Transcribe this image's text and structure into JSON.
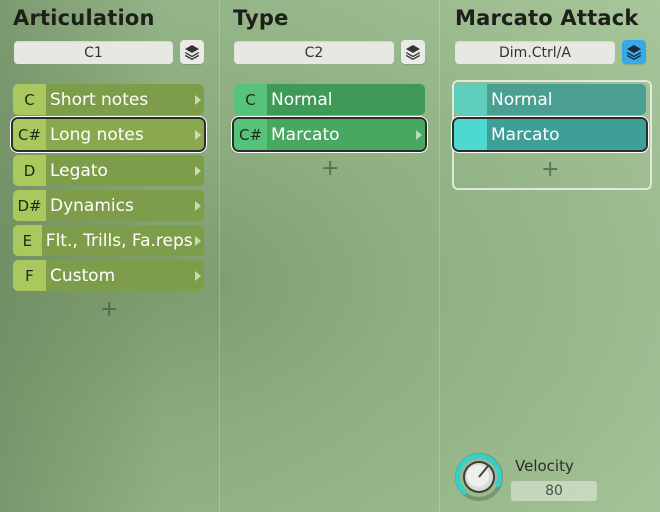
{
  "colors": {
    "accent_blue": "#37a9e6",
    "articulation_green": "#7e9d4b",
    "type_green": "#3f9a58",
    "teal": "#4a9e92"
  },
  "articulation": {
    "title": "Articulation",
    "key": "C1",
    "layer_icon": "layers-icon",
    "items": [
      {
        "key": "C",
        "label": "Short notes"
      },
      {
        "key": "C#",
        "label": "Long notes",
        "selected": true
      },
      {
        "key": "D",
        "label": "Legato"
      },
      {
        "key": "D#",
        "label": "Dynamics"
      },
      {
        "key": "E",
        "label": "Flt., Trills, Fa.reps"
      },
      {
        "key": "F",
        "label": "Custom"
      }
    ],
    "add_label": "+"
  },
  "type": {
    "title": "Type",
    "key": "C2",
    "layer_icon": "layers-icon",
    "items": [
      {
        "key": "C",
        "label": "Normal"
      },
      {
        "key": "C#",
        "label": "Marcato",
        "selected": true
      }
    ],
    "add_label": "+"
  },
  "marcato": {
    "title": "Marcato Attack",
    "key": "Dim.Ctrl/A",
    "layer_icon": "layers-icon",
    "items": [
      {
        "label": "Normal"
      },
      {
        "label": "Marcato",
        "selected": true
      }
    ],
    "add_label": "+"
  },
  "velocity": {
    "label": "Velocity",
    "value": "80"
  }
}
